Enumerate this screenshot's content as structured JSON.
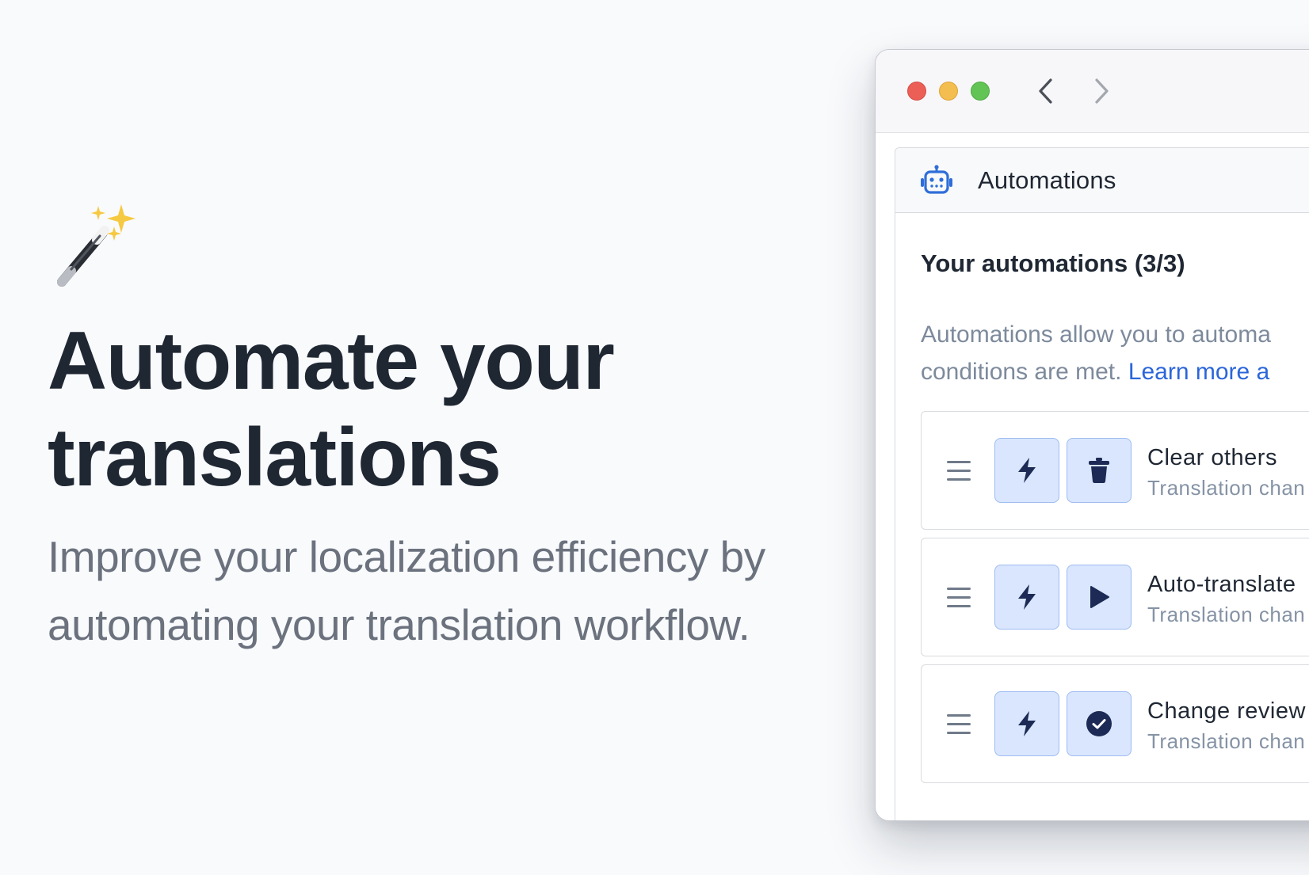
{
  "hero": {
    "icon": "magic-wand-sparkles-icon",
    "title_line1": "Automate your",
    "title_line2": "translations",
    "subtitle": "Improve your localization efficiency by automating your translation workflow."
  },
  "window": {
    "nav_back_icon": "chevron-left-icon",
    "nav_forward_icon": "chevron-right-icon",
    "panel": {
      "icon": "robot-icon",
      "title": "Automations"
    },
    "section_title": "Your automations (3/3)",
    "description_part1": "Automations allow you to automa",
    "description_part2": "conditions are met.",
    "learn_more": "Learn more a",
    "automations": [
      {
        "name": "Clear others",
        "subtitle": "Translation chan",
        "trigger_icon": "lightning-bolt-icon",
        "action_icon": "trash-icon"
      },
      {
        "name": "Auto-translate",
        "subtitle": "Translation chan",
        "trigger_icon": "lightning-bolt-icon",
        "action_icon": "play-icon"
      },
      {
        "name": "Change review",
        "subtitle": "Translation chan",
        "trigger_icon": "lightning-bolt-icon",
        "action_icon": "check-circle-icon"
      }
    ]
  },
  "colors": {
    "background": "#f9fafc",
    "title_text": "#1f2733",
    "subtitle_text": "#6b727e",
    "link": "#2b66d9",
    "icon_button_bg": "#d9e6fd",
    "icon_button_border": "#9ebbf2",
    "icon_dark": "#1c2a55",
    "traffic_red": "#ec5f56",
    "traffic_yellow": "#f4bd4f",
    "traffic_green": "#61c454"
  }
}
